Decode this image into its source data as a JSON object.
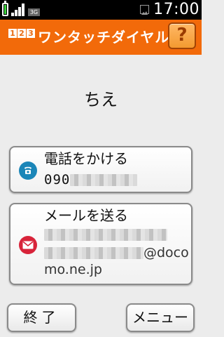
{
  "status_bar": {
    "time": "17:00",
    "network": "3G",
    "battery_color": "#3bd13b"
  },
  "header": {
    "app_icon_digits": [
      "1",
      "2",
      "3"
    ],
    "title": "ワンタッチダイヤル",
    "help_label": "?",
    "background": "#f26a0a"
  },
  "contact": {
    "name": "ちえ"
  },
  "actions": {
    "call": {
      "title": "電話をかける",
      "number_prefix": "090",
      "icon": "phone-icon",
      "icon_color": "#1b86b8"
    },
    "mail": {
      "title": "メールを送る",
      "address_visible_suffix": "@doco",
      "address_tail": "mo.ne.jp",
      "icon": "mail-icon",
      "icon_color": "#d8243a"
    }
  },
  "footer": {
    "exit_label": "終了",
    "menu_label": "メニュー"
  }
}
